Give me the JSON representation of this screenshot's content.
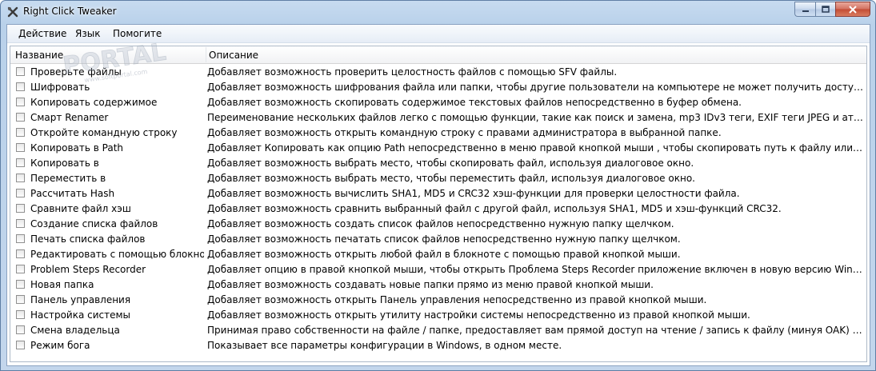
{
  "window": {
    "title": "Right Click Tweaker",
    "icon": "tools-icon"
  },
  "caption_buttons": {
    "minimize": "minimize-icon",
    "maximize": "maximize-icon",
    "close": "close-icon"
  },
  "watermark": {
    "text": "PORTAL",
    "subtext": "www.softportal.com"
  },
  "menu": [
    "Действие",
    "Язык",
    "Помогите"
  ],
  "columns": {
    "name": "Название",
    "description": "Описание"
  },
  "rows": [
    {
      "name": "Проверьте файлы",
      "description": "Добавляет возможность проверить целостность файлов с помощью SFV файлы.",
      "checked": false
    },
    {
      "name": "Шифровать",
      "description": "Добавляет возможность шифрования файла или папки, чтобы другие пользователи на компьютере не может получить доступ file.s",
      "checked": false
    },
    {
      "name": "Копировать содержимое",
      "description": "Добавляет возможность скопировать содержимое текстовых файлов непосредственно в буфер обмена.",
      "checked": false
    },
    {
      "name": "Смарт Renamer",
      "description": "Переименование нескольких файлов легко с помощью функции, такие как поиск и замена, mp3 IDv3 теги, EXIF теги JPEG и атрибуты файла данных.",
      "checked": false
    },
    {
      "name": "Откройте командную строку",
      "description": "Добавляет возможность открыть командную строку с правами администратора в выбранной папке.",
      "checked": false
    },
    {
      "name": "Копировать в Path",
      "description": "Добавляет Копировать как опцию Path непосредственно в меню правой кнопкой мыши , чтобы скопировать путь к файлу или папке.",
      "checked": false
    },
    {
      "name": "Копировать в",
      "description": "Добавляет возможность выбрать место, чтобы скопировать файл, используя диалоговое окно.",
      "checked": false
    },
    {
      "name": "Переместить в",
      "description": "Добавляет возможность выбрать место, чтобы переместить файл, используя диалоговое окно.",
      "checked": false
    },
    {
      "name": "Рассчитать Hash",
      "description": "Добавляет возможность вычислить SHA1, MD5 и CRC32 хэш-функции для проверки целостности файла.",
      "checked": false
    },
    {
      "name": "Сравните файл хэш",
      "description": "Добавляет возможность сравнить выбранный файл с другой файл, используя SHA1, MD5 и хэш-функций CRC32.",
      "checked": false
    },
    {
      "name": "Создание списка файлов",
      "description": "Добавляет возможность создать список файлов непосредственно нужную папку щелчком.",
      "checked": false
    },
    {
      "name": "Печать списка файлов",
      "description": "Добавляет возможность печатать список файлов непосредственно нужную папку щелчком.",
      "checked": false
    },
    {
      "name": "Редактировать с помощью блокнота",
      "description": "Добавляет возможность открыть любой файл в блокноте с помощью правой кнопкой мыши.",
      "checked": false
    },
    {
      "name": "Problem Steps Recorder",
      "description": "Добавляет опцию в правой кнопкой мыши, чтобы открыть Проблема Steps Recorder приложение включен в новую версию Windows.",
      "checked": false
    },
    {
      "name": "Новая папка",
      "description": "Добавляет возможность создавать новые папки прямо из меню правой кнопкой мыши.",
      "checked": false
    },
    {
      "name": "Панель управления",
      "description": "Добавляет возможность открыть Панель управления непосредственно из правой кнопкой мыши.",
      "checked": false
    },
    {
      "name": "Настройка системы",
      "description": "Добавляет возможность открыть утилиту настройки системы непосредственно из правой кнопкой мыши.",
      "checked": false
    },
    {
      "name": "Смена владельца",
      "description": "Принимая право собственности на файле / папке, предоставляет вам прямой доступ на чтение / запись к файлу (минуя OAK) и заставляет других ...",
      "checked": false
    },
    {
      "name": "Режим бога",
      "description": "Показывает все параметры конфигурации в Windows, в одном месте.",
      "checked": false
    }
  ]
}
